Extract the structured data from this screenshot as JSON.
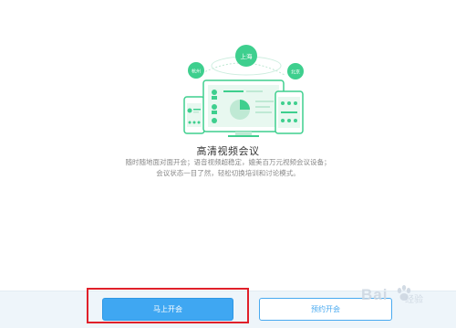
{
  "illustration": {
    "city_top": "上海",
    "city_left": "杭州",
    "city_right": "北京"
  },
  "feature": {
    "title": "高清视频会议",
    "desc_line1": "随时随地面对面开会；语音视频超稳定，媲美百万元视频会议设备；",
    "desc_line2": "会议状态一目了然，轻松切换培训和讨论模式。"
  },
  "actions": {
    "start_now": "马上开会",
    "schedule": "预约开会"
  },
  "watermark": {
    "brand": "Bai",
    "sub": "经验"
  },
  "colors": {
    "accent_green": "#3ecf8e",
    "accent_blue": "#3fa7f2",
    "highlight_red": "#e0202a"
  }
}
